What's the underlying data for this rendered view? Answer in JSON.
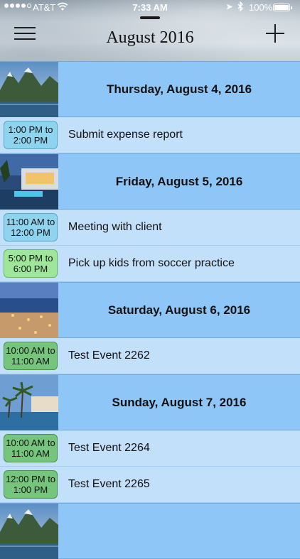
{
  "status_bar": {
    "carrier": "AT&T",
    "time": "7:33 AM",
    "battery": "100%",
    "battery_level": 1.0,
    "icons": [
      "signal-dots-icon",
      "wifi-icon",
      "location-icon",
      "bluetooth-icon",
      "battery-icon"
    ]
  },
  "header": {
    "title": "August 2016",
    "menu_icon": "hamburger-menu-icon",
    "add_icon": "plus-icon"
  },
  "colors": {
    "day_row_bg": "#8fc6f8",
    "event_row_bg": "#c3e0fb",
    "badge_blue": "#8fd4ee",
    "badge_lightgreen": "#9ee79a",
    "badge_green": "#76c57c"
  },
  "days": [
    {
      "title": "Thursday, August 4, 2016",
      "thumbnail": "mountain-fjord-photo",
      "events": [
        {
          "time": "1:00 PM to\n2:00 PM",
          "title": "Submit expense report",
          "color": "blue"
        }
      ]
    },
    {
      "title": "Friday, August 5, 2016",
      "thumbnail": "modern-house-pool-photo",
      "events": [
        {
          "time": "11:00 AM to\n12:00 PM",
          "title": "Meeting with client",
          "color": "blue"
        },
        {
          "time": "5:00 PM to\n6:00 PM",
          "title": "Pick up kids from soccer practice",
          "color": "lightgreen"
        }
      ]
    },
    {
      "title": "Saturday, August 6, 2016",
      "thumbnail": "beach-lights-photo",
      "events": [
        {
          "time": "10:00 AM to\n11:00 AM",
          "title": "Test Event 2262",
          "color": "green"
        }
      ]
    },
    {
      "title": "Sunday, August 7, 2016",
      "thumbnail": "palm-resort-photo",
      "events": [
        {
          "time": "10:00 AM to\n11:00 AM",
          "title": "Test Event 2264",
          "color": "green"
        },
        {
          "time": "12:00 PM to\n1:00 PM",
          "title": "Test Event 2265",
          "color": "green"
        }
      ]
    },
    {
      "title": "",
      "thumbnail": "mountain-fjord-photo",
      "events": []
    }
  ]
}
